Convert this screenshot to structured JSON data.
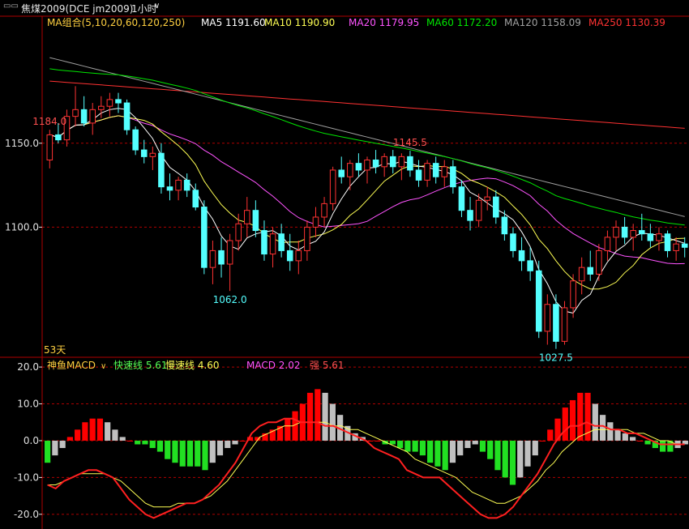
{
  "titlebar": {
    "symbol_label": "焦煤2009(DCE jm2009)",
    "period_label": "1小时"
  },
  "colors": {
    "up": "#ff3232",
    "down": "#54ffff",
    "ma5": "#ffffff",
    "ma10": "#ffff54",
    "ma20": "#ff54ff",
    "ma60": "#00e600",
    "ma120": "#a0a0a0",
    "ma250": "#ff3232",
    "grid": "#b00000",
    "axis_text": "#e0e0e0",
    "dif": "#ff2020",
    "dea": "#ffff54",
    "macd_pos": "#ff0000",
    "macd_neg_a": "#22e022",
    "macd_neg_b": "#c0c0c0"
  },
  "chart_data": [
    {
      "type": "candlestick",
      "legend": {
        "group_label": "MA组合(5,10,20,60,120,250)",
        "items": [
          {
            "label": "MA5 1191.60",
            "color_key": "ma5"
          },
          {
            "label": "MA10 1190.90",
            "color_key": "ma10"
          },
          {
            "label": "MA20 1179.95",
            "color_key": "ma20"
          },
          {
            "label": "MA60 1172.20",
            "color_key": "ma60"
          },
          {
            "label": "MA120 1158.09",
            "color_key": "ma120"
          },
          {
            "label": "MA250 1130.39",
            "color_key": "ma250"
          }
        ]
      },
      "y_ticks": [
        "1150.0",
        "1100.0"
      ],
      "ylim": [
        1023,
        1216
      ],
      "annotations": [
        {
          "text": "1184.0",
          "color": "#ff5050"
        },
        {
          "text": "1062.0",
          "color": "#54ffff"
        },
        {
          "text": "1145.5",
          "color": "#ff5050"
        },
        {
          "text": "1027.5",
          "color": "#54ffff"
        }
      ],
      "period_note": "53天",
      "candles_ohlc": [
        [
          1140,
          1158,
          1135,
          1155
        ],
        [
          1155,
          1162,
          1150,
          1152
        ],
        [
          1152,
          1170,
          1148,
          1166
        ],
        [
          1166,
          1184,
          1160,
          1170
        ],
        [
          1170,
          1178,
          1160,
          1162
        ],
        [
          1162,
          1174,
          1155,
          1170
        ],
        [
          1170,
          1178,
          1165,
          1172
        ],
        [
          1172,
          1180,
          1166,
          1176
        ],
        [
          1176,
          1180,
          1168,
          1174
        ],
        [
          1174,
          1176,
          1155,
          1158
        ],
        [
          1158,
          1160,
          1143,
          1146
        ],
        [
          1146,
          1152,
          1138,
          1142
        ],
        [
          1142,
          1148,
          1134,
          1144
        ],
        [
          1144,
          1150,
          1120,
          1124
        ],
        [
          1124,
          1132,
          1116,
          1122
        ],
        [
          1122,
          1130,
          1116,
          1128
        ],
        [
          1128,
          1132,
          1118,
          1122
        ],
        [
          1122,
          1126,
          1110,
          1112
        ],
        [
          1112,
          1116,
          1072,
          1076
        ],
        [
          1076,
          1092,
          1066,
          1086
        ],
        [
          1086,
          1094,
          1070,
          1078
        ],
        [
          1078,
          1096,
          1062,
          1092
        ],
        [
          1092,
          1108,
          1086,
          1102
        ],
        [
          1102,
          1118,
          1094,
          1110
        ],
        [
          1110,
          1116,
          1094,
          1098
        ],
        [
          1098,
          1104,
          1080,
          1084
        ],
        [
          1084,
          1100,
          1076,
          1096
        ],
        [
          1096,
          1102,
          1082,
          1086
        ],
        [
          1086,
          1096,
          1074,
          1080
        ],
        [
          1080,
          1092,
          1072,
          1086
        ],
        [
          1086,
          1104,
          1080,
          1100
        ],
        [
          1100,
          1112,
          1094,
          1106
        ],
        [
          1106,
          1118,
          1100,
          1114
        ],
        [
          1114,
          1136,
          1110,
          1134
        ],
        [
          1134,
          1142,
          1126,
          1130
        ],
        [
          1130,
          1140,
          1122,
          1138
        ],
        [
          1138,
          1144,
          1130,
          1134
        ],
        [
          1134,
          1142,
          1126,
          1140
        ],
        [
          1140,
          1146,
          1132,
          1136
        ],
        [
          1136,
          1144,
          1130,
          1142
        ],
        [
          1142,
          1146,
          1132,
          1136
        ],
        [
          1136,
          1144,
          1128,
          1142
        ],
        [
          1142,
          1145.5,
          1130,
          1134
        ],
        [
          1134,
          1140,
          1124,
          1128
        ],
        [
          1128,
          1140,
          1124,
          1138
        ],
        [
          1138,
          1142,
          1126,
          1130
        ],
        [
          1130,
          1140,
          1124,
          1136
        ],
        [
          1136,
          1140,
          1120,
          1124
        ],
        [
          1124,
          1128,
          1106,
          1110
        ],
        [
          1110,
          1118,
          1098,
          1104
        ],
        [
          1104,
          1120,
          1100,
          1116
        ],
        [
          1116,
          1124,
          1110,
          1118
        ],
        [
          1118,
          1122,
          1102,
          1106
        ],
        [
          1106,
          1110,
          1092,
          1096
        ],
        [
          1096,
          1100,
          1082,
          1086
        ],
        [
          1086,
          1094,
          1074,
          1080
        ],
        [
          1080,
          1088,
          1068,
          1074
        ],
        [
          1074,
          1080,
          1034,
          1038
        ],
        [
          1038,
          1060,
          1030,
          1054
        ],
        [
          1054,
          1060,
          1027.5,
          1032
        ],
        [
          1032,
          1056,
          1030,
          1052
        ],
        [
          1052,
          1072,
          1046,
          1068
        ],
        [
          1068,
          1082,
          1060,
          1076
        ],
        [
          1076,
          1086,
          1068,
          1072
        ],
        [
          1072,
          1090,
          1068,
          1086
        ],
        [
          1086,
          1098,
          1080,
          1094
        ],
        [
          1094,
          1104,
          1086,
          1100
        ],
        [
          1100,
          1106,
          1090,
          1094
        ],
        [
          1094,
          1102,
          1086,
          1098
        ],
        [
          1098,
          1108,
          1092,
          1096
        ],
        [
          1096,
          1102,
          1088,
          1092
        ],
        [
          1092,
          1100,
          1086,
          1096
        ],
        [
          1096,
          1098,
          1082,
          1086
        ],
        [
          1086,
          1094,
          1080,
          1090
        ],
        [
          1090,
          1094,
          1082,
          1088
        ]
      ]
    },
    {
      "type": "macd",
      "legend": {
        "group_label": "神鱼MACD",
        "items": [
          {
            "label": "快速线 5.61",
            "color": "#54ff54"
          },
          {
            "label": "慢速线 4.60",
            "color": "#ffff54"
          },
          {
            "label": "MACD 2.02",
            "color": "#ff54ff"
          },
          {
            "label": "强 5.61",
            "color": "#ff5050"
          }
        ]
      },
      "y_ticks": [
        "20.0",
        "10.0",
        "0.0",
        "-10.0",
        "-20.0"
      ],
      "ylim": [
        -24,
        22
      ],
      "hist": [
        -6,
        -4,
        -2,
        1,
        3,
        5,
        6,
        6,
        5,
        3,
        1,
        0,
        -1,
        -1,
        -2,
        -3,
        -5,
        -6,
        -7,
        -7,
        -7,
        -8,
        -6,
        -4,
        -2,
        -1,
        0,
        1,
        1,
        2,
        3,
        4,
        6,
        8,
        10,
        13,
        14,
        13,
        10,
        7,
        4,
        2,
        1,
        0,
        0,
        -1,
        -1,
        -2,
        -3,
        -3,
        -4,
        -6,
        -7,
        -8,
        -6,
        -4,
        -2,
        -1,
        -3,
        -5,
        -8,
        -10,
        -12,
        -10,
        -7,
        -4,
        0,
        3,
        6,
        9,
        11,
        13,
        13,
        10,
        7,
        5,
        3,
        2,
        1,
        0,
        -1,
        -2,
        -3,
        -3,
        -2,
        -1
      ],
      "fast": [
        -12,
        -13,
        -11,
        -10,
        -9,
        -8,
        -8,
        -9,
        -10,
        -13,
        -16,
        -18,
        -20,
        -21,
        -20,
        -19,
        -18,
        -17,
        -17,
        -16,
        -14,
        -12,
        -9,
        -6,
        -2,
        2,
        4,
        5,
        5,
        6,
        6,
        5,
        5,
        5,
        4,
        4,
        3,
        2,
        1,
        0,
        -2,
        -3,
        -4,
        -5,
        -8,
        -9,
        -10,
        -10,
        -10,
        -12,
        -14,
        -16,
        -18,
        -20,
        -21,
        -21,
        -20,
        -18,
        -15,
        -12,
        -9,
        -5,
        -1,
        2,
        4,
        4,
        5,
        4,
        4,
        3,
        3,
        2,
        2,
        1,
        0,
        -1,
        -1,
        -1,
        -1
      ],
      "slow": [
        -12,
        -12,
        -11,
        -10,
        -9,
        -9,
        -9,
        -9,
        -10,
        -11,
        -13,
        -15,
        -17,
        -18,
        -18,
        -18,
        -17,
        -17,
        -17,
        -16,
        -15,
        -13,
        -11,
        -8,
        -5,
        -2,
        1,
        2,
        3,
        4,
        4,
        5,
        5,
        5,
        5,
        4,
        4,
        3,
        3,
        2,
        1,
        0,
        -1,
        -2,
        -3,
        -5,
        -6,
        -7,
        -8,
        -9,
        -10,
        -12,
        -14,
        -15,
        -16,
        -17,
        -17,
        -16,
        -15,
        -13,
        -11,
        -8,
        -6,
        -3,
        -1,
        1,
        2,
        3,
        3,
        3,
        3,
        3,
        2,
        2,
        1,
        0,
        0,
        -1,
        -1
      ]
    }
  ]
}
